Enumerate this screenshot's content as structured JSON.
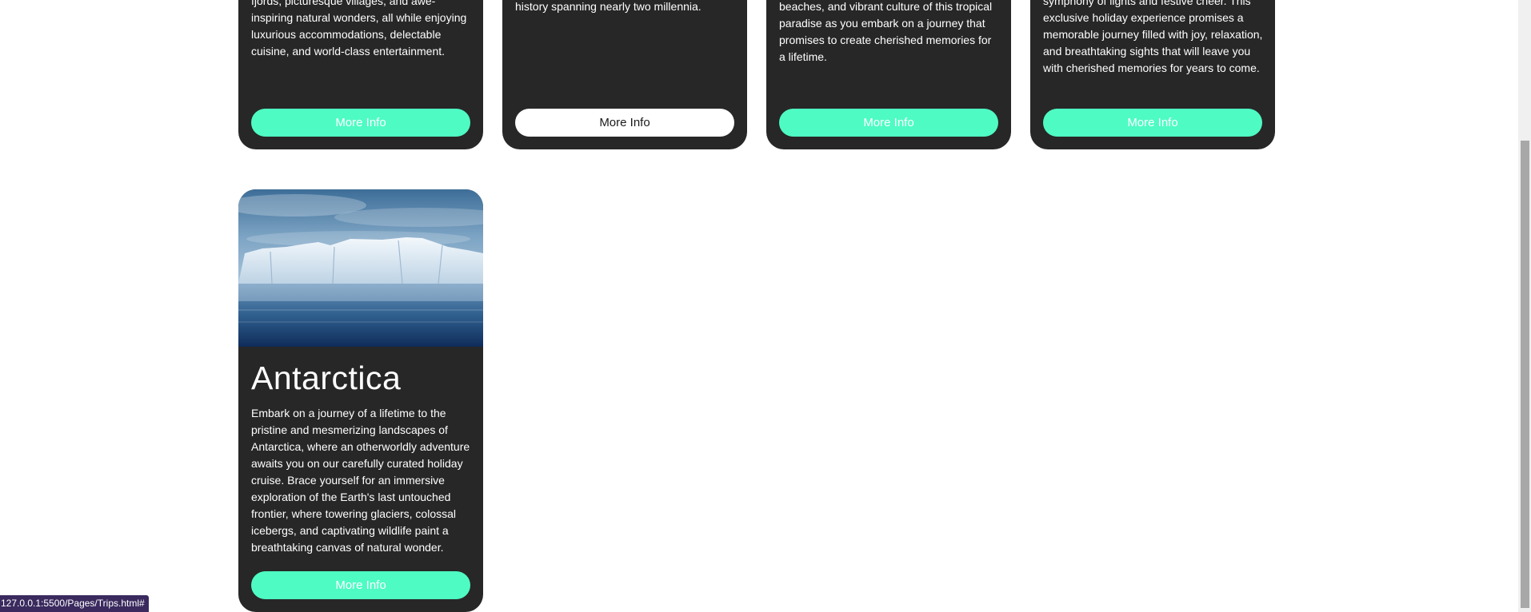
{
  "cards": [
    {
      "description": "fjords, picturesque villages, and awe-inspiring natural wonders, all while enjoying luxurious accommodations, delectable cuisine, and world-class entertainment.",
      "button_label": "More Info",
      "button_style": "teal"
    },
    {
      "description": "history spanning nearly two millennia.",
      "button_label": "More Info",
      "button_style": "white"
    },
    {
      "description": "beaches, and vibrant culture of this tropical paradise as you embark on a journey that promises to create cherished memories for a lifetime.",
      "button_label": "More Info",
      "button_style": "teal"
    },
    {
      "description": "symphony of lights and festive cheer. This exclusive holiday experience promises a memorable journey filled with joy, relaxation, and breathtaking sights that will leave you with cherished memories for years to come.",
      "button_label": "More Info",
      "button_style": "teal"
    },
    {
      "title": "Antarctica",
      "image": "antarctica-iceberg",
      "description": "Embark on a journey of a lifetime to the pristine and mesmerizing landscapes of Antarctica, where an otherworldly adventure awaits you on our carefully curated holiday cruise. Brace yourself for an immersive exploration of the Earth's last untouched frontier, where towering glaciers, colossal icebergs, and captivating wildlife paint a breathtaking canvas of natural wonder.",
      "button_label": "More Info",
      "button_style": "teal"
    }
  ],
  "status_bar": {
    "url": "127.0.0.1:5500/Pages/Trips.html#"
  },
  "colors": {
    "card_background": "#272727",
    "accent_button": "#4efcc3",
    "page_background": "#ffffff"
  }
}
